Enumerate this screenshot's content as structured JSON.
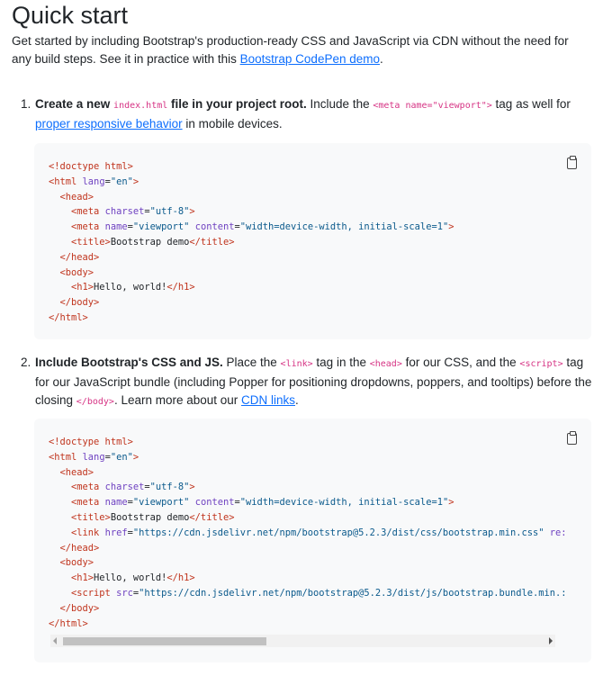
{
  "page": {
    "title": "Quick start",
    "intro_text": "Get started by including Bootstrap's production-ready CSS and JavaScript via CDN without the need for any build steps. See it in practice with this ",
    "intro_link": "Bootstrap CodePen demo",
    "intro_end": "."
  },
  "step1": {
    "number": "1.",
    "bold_a": "Create a new ",
    "code_a": "index.html",
    "bold_b": " file in your project root.",
    "text_a": " Include the ",
    "code_b": "<meta name=\"viewport\">",
    "text_b": " tag as well for ",
    "link": "proper responsive behavior",
    "text_c": " in mobile devices."
  },
  "step2": {
    "number": "2.",
    "bold": "Include Bootstrap's CSS and JS.",
    "text_a": " Place the ",
    "code_a": "<link>",
    "text_b": " tag in the ",
    "code_b": "<head>",
    "text_c": " for our CSS, and the ",
    "code_c": "<script>",
    "text_d": " tag for our JavaScript bundle (including Popper for positioning dropdowns, poppers, and tooltips) before the closing ",
    "code_d": "</body>",
    "text_e": ". Learn more about our ",
    "link": "CDN links",
    "text_f": "."
  },
  "code1_lines": [
    "<!doctype html>",
    "<html lang=\"en\">",
    "  <head>",
    "    <meta charset=\"utf-8\">",
    "    <meta name=\"viewport\" content=\"width=device-width, initial-scale=1\">",
    "    <title>Bootstrap demo</title>",
    "  </head>",
    "  <body>",
    "    <h1>Hello, world!</h1>",
    "  </body>",
    "</html>"
  ],
  "code2_lines": [
    "<!doctype html>",
    "<html lang=\"en\">",
    "  <head>",
    "    <meta charset=\"utf-8\">",
    "    <meta name=\"viewport\" content=\"width=device-width, initial-scale=1\">",
    "    <title>Bootstrap demo</title>",
    "    <link href=\"https://cdn.jsdelivr.net/npm/bootstrap@5.2.3/dist/css/bootstrap.min.css\" re:",
    "  </head>",
    "  <body>",
    "    <h1>Hello, world!</h1>",
    "    <script src=\"https://cdn.jsdelivr.net/npm/bootstrap@5.2.3/dist/js/bootstrap.bundle.min.:",
    "  </body>",
    "</html>"
  ],
  "icons": {
    "copy": "clipboard-icon"
  },
  "colors": {
    "link": "#0d6efd",
    "inline_code": "#d63384",
    "code_bg": "#f8f9fa"
  }
}
